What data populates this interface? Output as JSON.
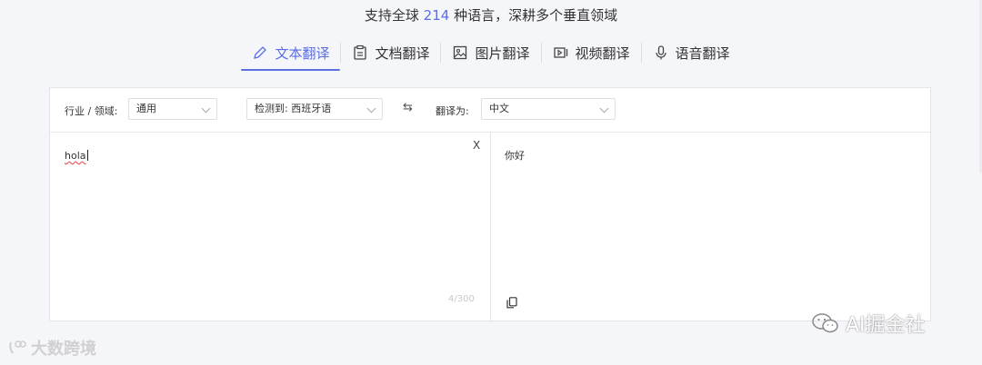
{
  "headline": {
    "prefix": "支持全球",
    "count": "214",
    "suffix": "种语言，深耕多个垂直领域"
  },
  "tabs": [
    {
      "label": "文本翻译",
      "icon": "pencil-icon",
      "active": true
    },
    {
      "label": "文档翻译",
      "icon": "document-icon",
      "active": false
    },
    {
      "label": "图片翻译",
      "icon": "image-icon",
      "active": false
    },
    {
      "label": "视频翻译",
      "icon": "video-icon",
      "active": false
    },
    {
      "label": "语音翻译",
      "icon": "microphone-icon",
      "active": false
    }
  ],
  "toolbar": {
    "domain_label": "行业 / 领域:",
    "domain_value": "通用",
    "detected_value": "检测到: 西班牙语",
    "swap_icon": "⇆",
    "target_label": "翻译为:",
    "target_value": "中文"
  },
  "source": {
    "text": "hola",
    "clear_label": "X",
    "counter": "4/300"
  },
  "target": {
    "text": "你好"
  },
  "watermarks": {
    "left": "大数跨境",
    "right": "AI掘金社"
  },
  "colors": {
    "accent": "#5b6ee1"
  }
}
